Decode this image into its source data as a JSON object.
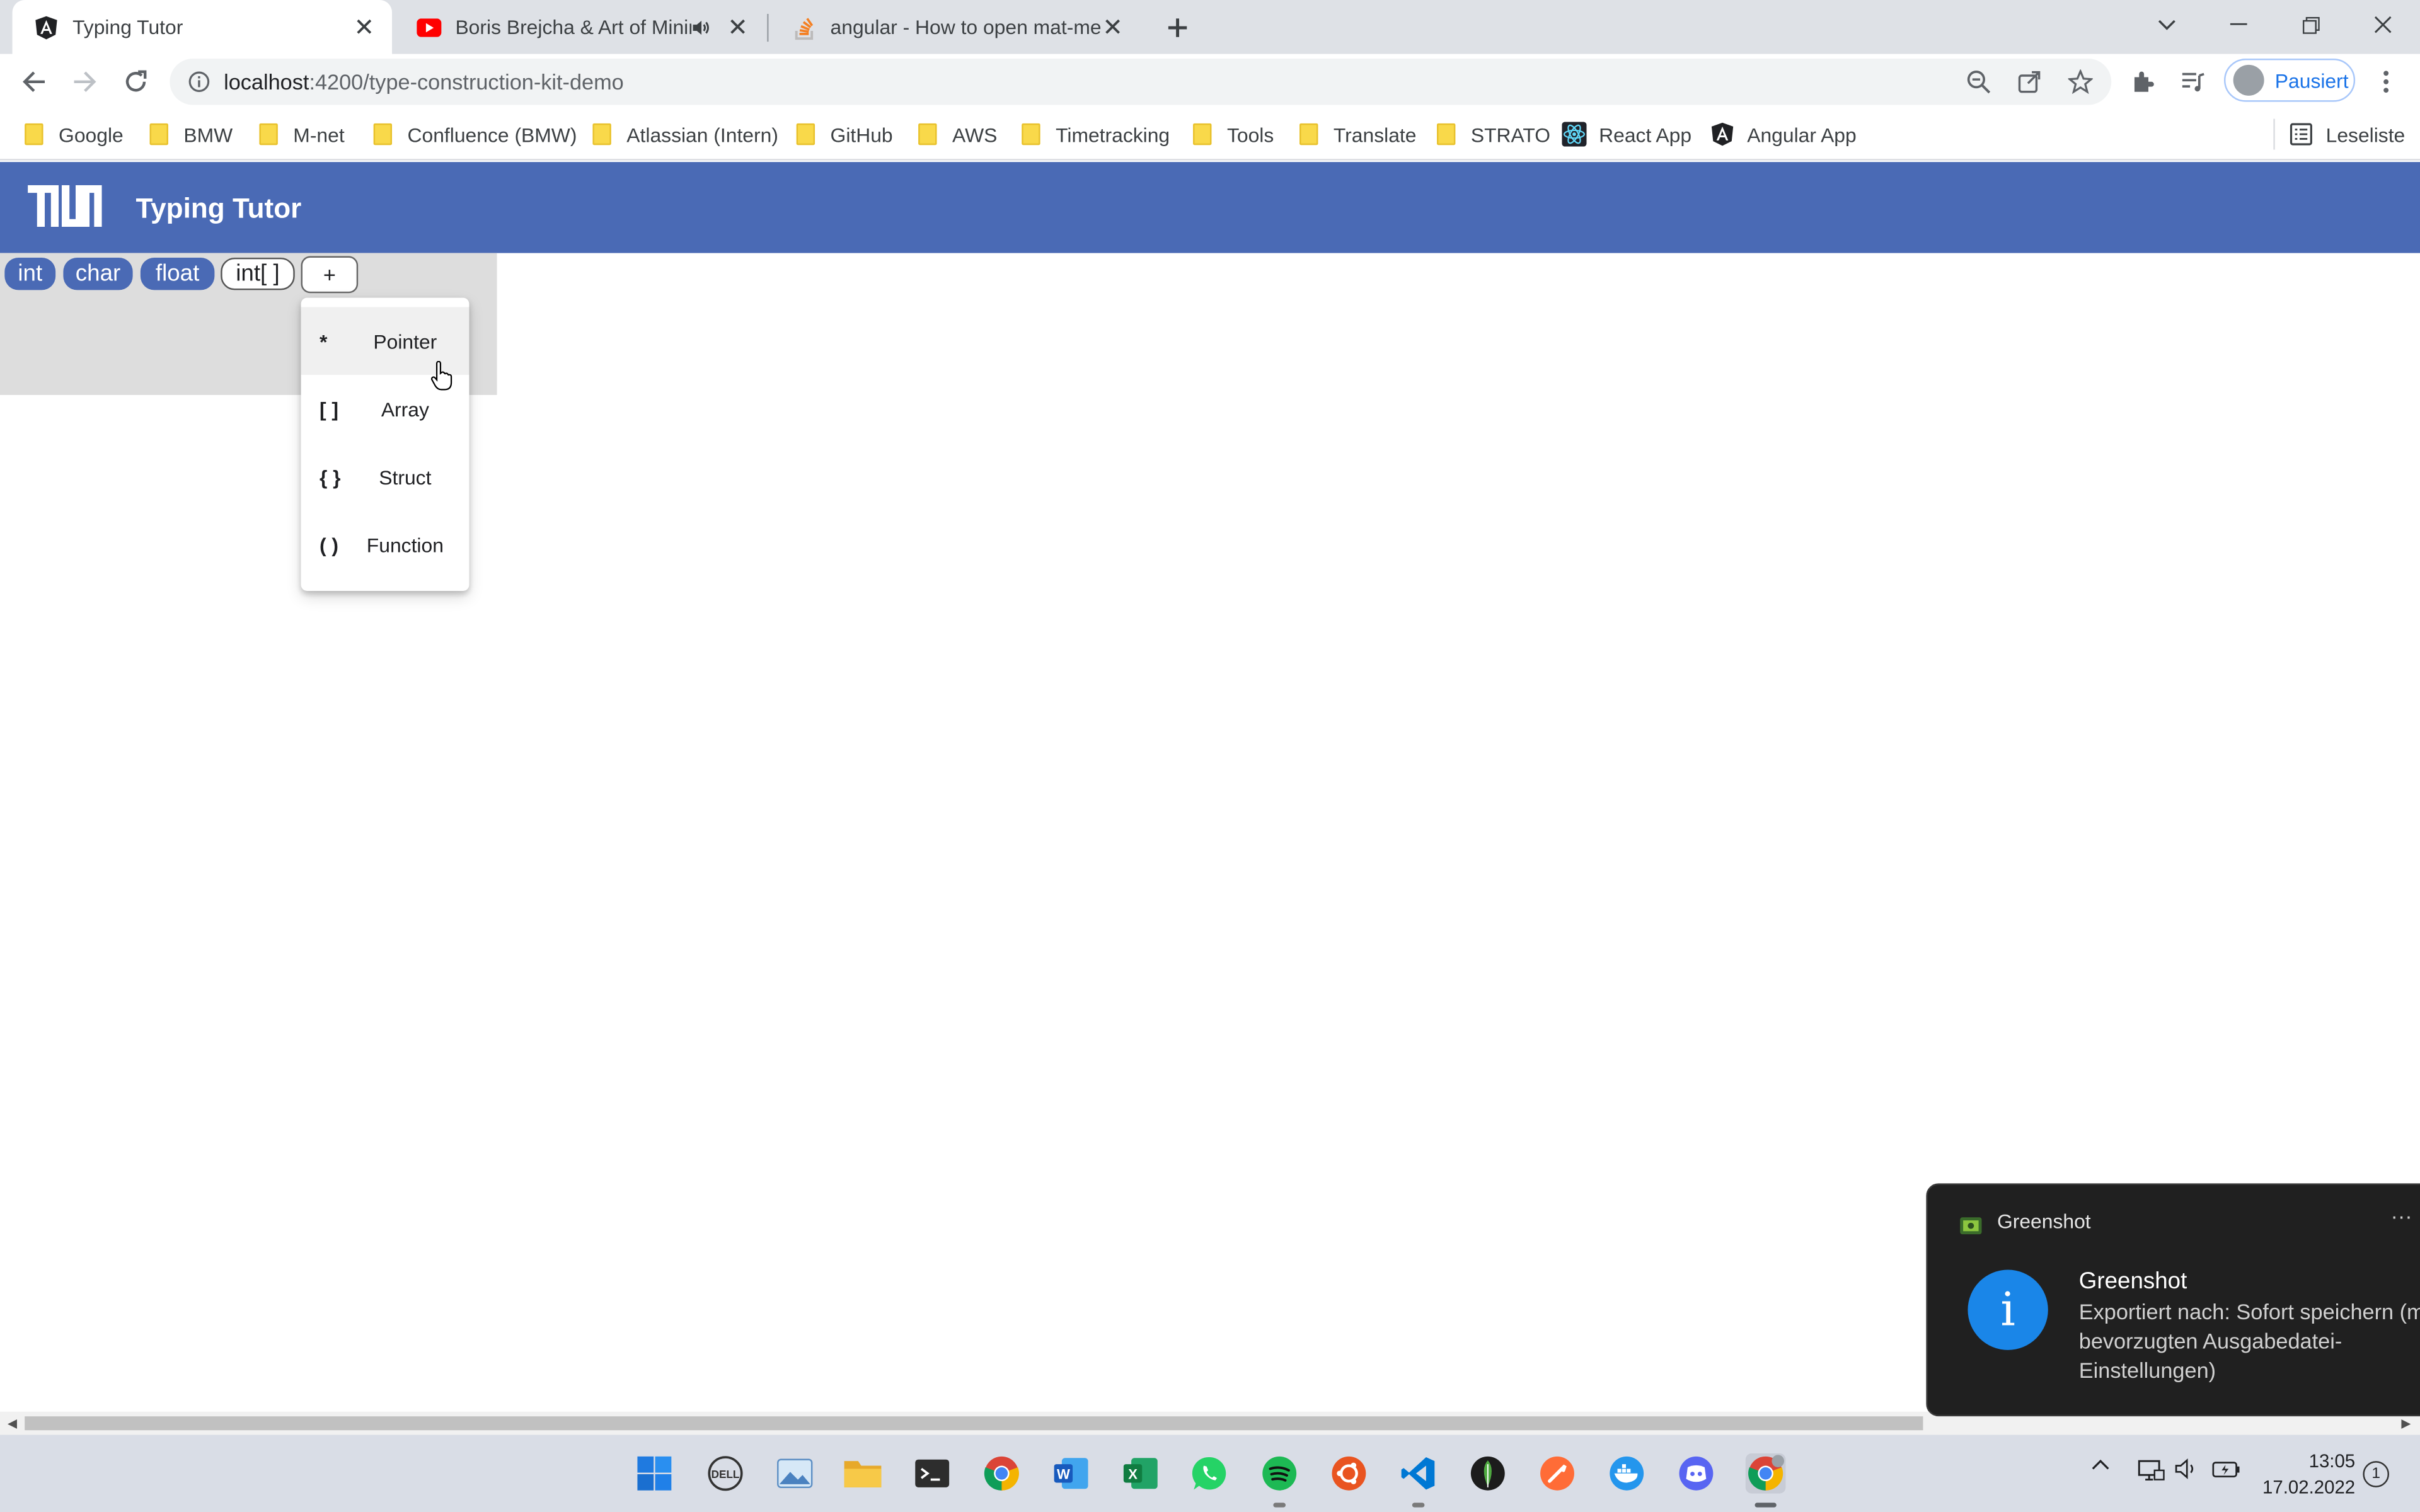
{
  "browser": {
    "tabs": [
      {
        "title": "Typing Tutor",
        "favicon": "angular-icon",
        "active": true
      },
      {
        "title": "Boris Brejcha & Art of Minim",
        "favicon": "youtube-icon",
        "audio": true
      },
      {
        "title": "angular - How to open mat-men",
        "favicon": "stackoverflow-icon"
      }
    ],
    "url_host": "localhost",
    "url_path": ":4200/type-construction-kit-demo",
    "profile_label": "Pausiert",
    "bookmarks": [
      "Google",
      "BMW",
      "M-net",
      "Confluence (BMW)",
      "Atlassian (Intern)",
      "GitHub",
      "AWS",
      "Timetracking",
      "Tools",
      "Translate",
      "STRATO",
      "React App",
      "Angular App"
    ],
    "reading_list": "Leseliste"
  },
  "app": {
    "title": "Typing Tutor",
    "chips": [
      "int",
      "char",
      "float",
      "int[ ]"
    ],
    "add_label": "+",
    "menu": [
      {
        "symbol": "*",
        "label": "Pointer"
      },
      {
        "symbol": "[ ]",
        "label": "Array"
      },
      {
        "symbol": "{ }",
        "label": "Struct"
      },
      {
        "symbol": "( )",
        "label": "Function"
      }
    ],
    "colors": {
      "primary": "#4a6ab5",
      "panel": "#dddddd"
    }
  },
  "toast": {
    "app": "Greenshot",
    "more": "···",
    "title": "Greenshot",
    "body": "Exportiert nach: Sofort speichern (mit bevorzugten Ausgabedatei-Einstellungen)"
  },
  "taskbar": {
    "time": "13:05",
    "date": "17.02.2022",
    "notifications": "1"
  }
}
